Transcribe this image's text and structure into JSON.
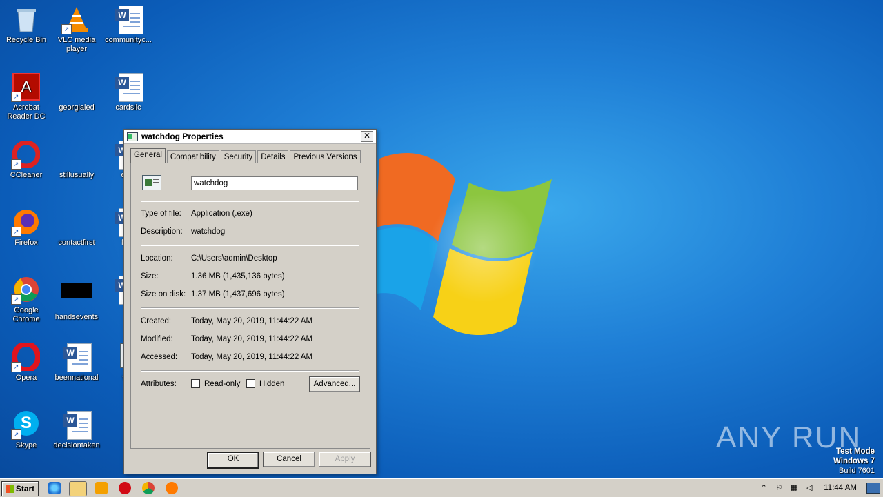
{
  "desktop": {
    "icons": [
      {
        "label": "Recycle Bin"
      },
      {
        "label": "VLC media player"
      },
      {
        "label": "communityc..."
      },
      {
        "label": "Acrobat Reader DC"
      },
      {
        "label": "georgialed"
      },
      {
        "label": "cardsllc"
      },
      {
        "label": "CCleaner"
      },
      {
        "label": "stillusually"
      },
      {
        "label": "ever"
      },
      {
        "label": "Firefox"
      },
      {
        "label": "contactfirst"
      },
      {
        "label": "follo"
      },
      {
        "label": "Google Chrome"
      },
      {
        "label": "handsevents"
      },
      {
        "label": "lin"
      },
      {
        "label": "Opera"
      },
      {
        "label": "beennational"
      },
      {
        "label": "wat"
      },
      {
        "label": "Skype"
      },
      {
        "label": "decisiontaken"
      }
    ]
  },
  "dialog": {
    "title": "watchdog Properties",
    "close_label": "✕",
    "tabs": [
      "General",
      "Compatibility",
      "Security",
      "Details",
      "Previous Versions"
    ],
    "active_tab": "General",
    "file_name": "watchdog",
    "fields": {
      "type_label": "Type of file:",
      "type_value": "Application (.exe)",
      "desc_label": "Description:",
      "desc_value": "watchdog",
      "location_label": "Location:",
      "location_value": "C:\\Users\\admin\\Desktop",
      "size_label": "Size:",
      "size_value": "1.36 MB (1,435,136 bytes)",
      "disk_label": "Size on disk:",
      "disk_value": "1.37 MB (1,437,696 bytes)",
      "created_label": "Created:",
      "created_value": "Today, May 20, 2019, 11:44:22 AM",
      "modified_label": "Modified:",
      "modified_value": "Today, May 20, 2019, 11:44:22 AM",
      "accessed_label": "Accessed:",
      "accessed_value": "Today, May 20, 2019, 11:44:22 AM",
      "attributes_label": "Attributes:"
    },
    "attributes": {
      "readonly_label": "Read-only",
      "readonly_checked": false,
      "hidden_label": "Hidden",
      "hidden_checked": false
    },
    "buttons": {
      "advanced": "Advanced...",
      "ok": "OK",
      "cancel": "Cancel",
      "apply": "Apply"
    }
  },
  "taskbar": {
    "start_label": "Start",
    "clock": "11:44 AM"
  },
  "watermark": {
    "line1": "Test Mode",
    "line2": "Windows 7",
    "line3": "Build 7601",
    "brand": "ANY RUN"
  },
  "colors": {
    "desktop_accent": "#1f7fd6",
    "dialog_bg": "#d4d0c8"
  }
}
